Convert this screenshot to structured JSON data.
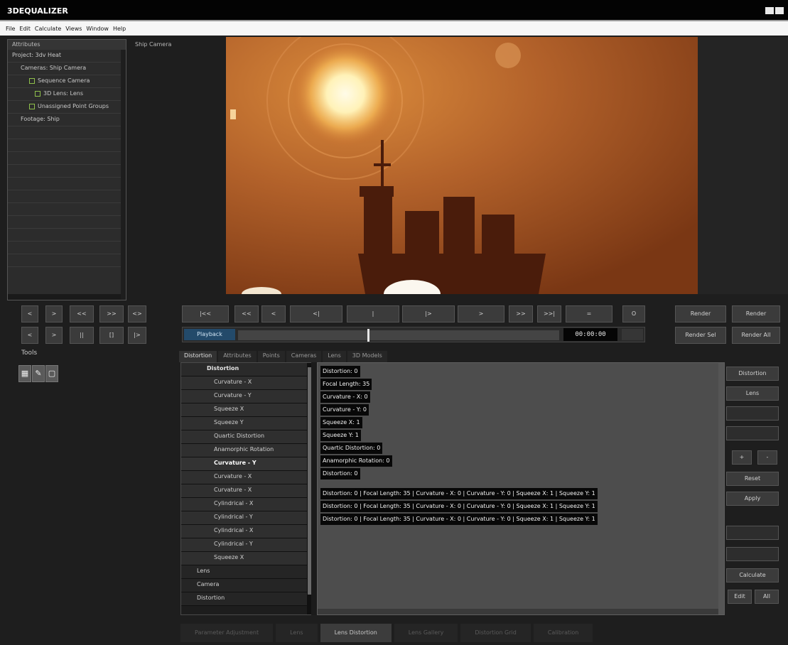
{
  "window": {
    "title": "3DEQUALIZER"
  },
  "menu": [
    "File",
    "Edit",
    "Calculate",
    "Views",
    "Window",
    "Help"
  ],
  "outliner": {
    "header": "Attributes",
    "rows": [
      {
        "label": "Project: 3dv Heat",
        "indent": 0
      },
      {
        "label": "Cameras: Ship Camera",
        "indent": 0
      },
      {
        "label": "Sequence Camera",
        "indent": 1
      },
      {
        "label": "3D Lens: Lens",
        "indent": 2
      },
      {
        "label": "Unassigned Point Groups",
        "indent": 1
      },
      {
        "label": "Footage: Ship",
        "indent": 0
      }
    ]
  },
  "viewport_label": "Ship Camera",
  "transport": {
    "row1_left": [
      "<",
      ">",
      "<<",
      ">>",
      "<>"
    ],
    "row2_left": [
      "<",
      ">",
      "||",
      "[]",
      "|>"
    ],
    "row1_mid": [
      "|<<",
      "<<",
      "<",
      "<|",
      "|",
      "|>",
      ">",
      ">>",
      ">>|",
      "=",
      "O"
    ],
    "timecode": "00:00:00",
    "mode": "Playback"
  },
  "right_buttons": {
    "r1a": "Render",
    "r1b": "Render",
    "r2a": "Render Sel",
    "r2b": "Render All"
  },
  "tools": {
    "title": "Tools",
    "icons": [
      "▦",
      "✎",
      "▢"
    ]
  },
  "tabs": [
    "Distortion",
    "Attributes",
    "Points",
    "Cameras",
    "Lens",
    "3D Models"
  ],
  "tree": {
    "header": "Distortion",
    "items": [
      "Distortion",
      "Curvature - X",
      "Curvature - Y",
      "Squeeze X",
      "Squeeze Y",
      "Quartic Distortion",
      "Anamorphic Rotation",
      "Curvature - Y",
      "Curvature - X",
      "Curvature - X",
      "Cylindrical - X",
      "Cylindrical - Y",
      "Cylindrical - X",
      "Cylindrical - Y",
      "Squeeze X",
      "Squeeze Y",
      "Quartic Distortion"
    ],
    "groups": [
      "Lens",
      "Camera",
      "Distortion"
    ]
  },
  "props": {
    "kv": [
      "Distortion: 0",
      "Focal Length: 35",
      "Curvature - X: 0",
      "Curvature - Y: 0",
      "Squeeze X: 1",
      "Squeeze Y: 1",
      "Quartic Distortion: 0",
      "Anamorphic Rotation: 0",
      "Distortion: 0"
    ],
    "lines": [
      "Distortion: 0 | Focal Length: 35 | Curvature - X: 0 | Curvature - Y: 0 | Squeeze X: 1 | Squeeze Y: 1",
      "Distortion: 0 | Focal Length: 35 | Curvature - X: 0 | Curvature - Y: 0 | Squeeze X: 1 | Squeeze Y: 1",
      "Distortion: 0 | Focal Length: 35 | Curvature - X: 0 | Curvature - Y: 0 | Squeeze X: 1 | Squeeze Y: 1"
    ]
  },
  "right_col": {
    "b1": "Distortion",
    "b2": "Lens",
    "b3": "",
    "b4": "",
    "p1": "+",
    "p2": "-",
    "b5": "Reset",
    "b6": "Apply",
    "b7": "",
    "b8": "",
    "b9": "Calculate",
    "m1": "Edit",
    "m2": "All"
  },
  "bottom_tabs": [
    "Parameter Adjustment",
    "Lens",
    "Lens Distortion",
    "Lens Gallery",
    "Distortion Grid",
    "Calibration"
  ]
}
